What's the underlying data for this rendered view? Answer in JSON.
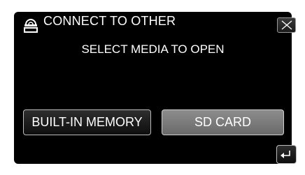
{
  "dialog": {
    "title": "CONNECT TO OTHER",
    "subtitle": "SELECT MEDIA TO OPEN",
    "header_icon": "disc-drive-icon",
    "close_icon": "close-icon",
    "back_icon": "back-return-icon"
  },
  "buttons": {
    "built_in_memory": "BUILT-IN MEMORY",
    "sd_card": "SD CARD"
  },
  "colors": {
    "background": "#000000",
    "text": "#ffffff",
    "selected_button": "#7a7a7a",
    "button_border": "#bdbdbd"
  }
}
